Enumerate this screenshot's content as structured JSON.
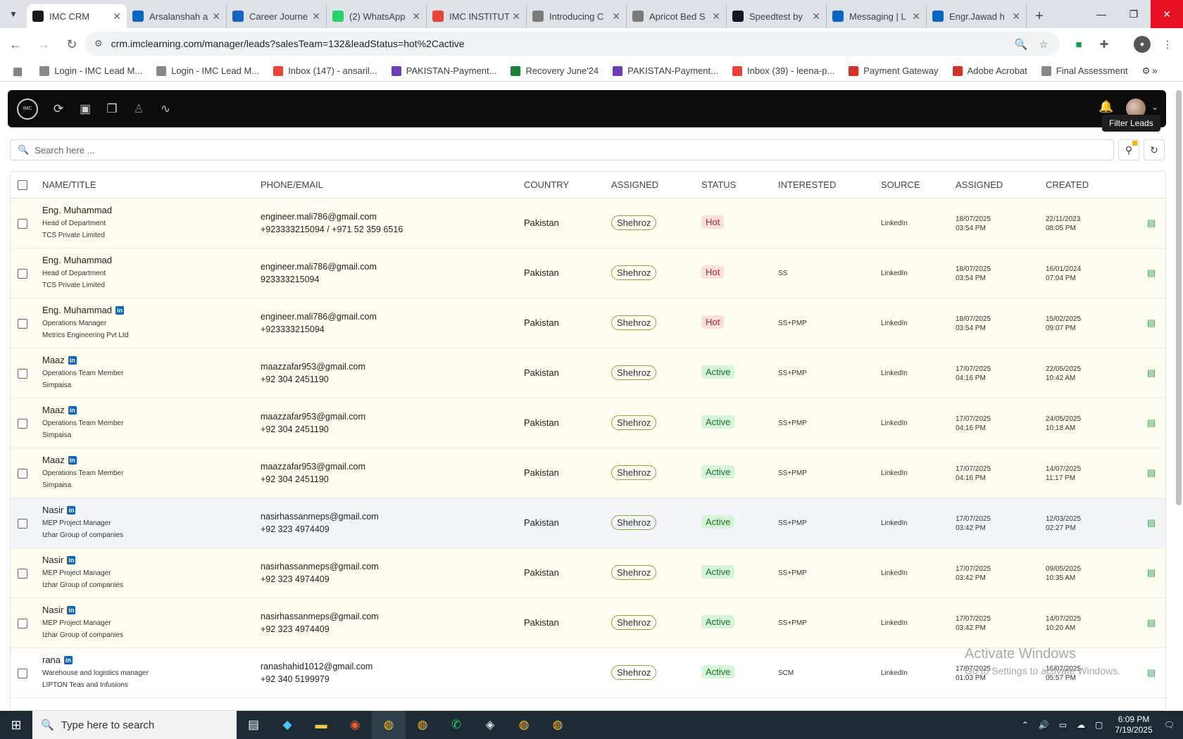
{
  "browser": {
    "tabs": [
      {
        "title": "IMC CRM",
        "fav": "#1a1a1a",
        "active": true
      },
      {
        "title": "Arsalanshah a",
        "fav": "#0a66c2"
      },
      {
        "title": "Career Journe",
        "fav": "#1565c0"
      },
      {
        "title": "(2) WhatsApp",
        "fav": "#25d366"
      },
      {
        "title": "IMC INSTITUT",
        "fav": "#ea4335"
      },
      {
        "title": "Introducing C",
        "fav": "#7a7a7a"
      },
      {
        "title": "Apricot Bed S",
        "fav": "#7a7a7a"
      },
      {
        "title": "Speedtest by",
        "fav": "#141526"
      },
      {
        "title": "Messaging | L",
        "fav": "#0a66c2"
      },
      {
        "title": "Engr.Jawad h",
        "fav": "#0a66c2"
      }
    ],
    "url": "crm.imclearning.com/manager/leads?salesTeam=132&leadStatus=hot%2Cactive",
    "bookmarks": [
      {
        "label": "Login - IMC Lead M...",
        "color": "#888"
      },
      {
        "label": "Login - IMC Lead M...",
        "color": "#888"
      },
      {
        "label": "Inbox (147) - ansaril...",
        "color": "#ea4335"
      },
      {
        "label": "PAKISTAN-Payment...",
        "color": "#6a3fb5"
      },
      {
        "label": "Recovery June'24",
        "color": "#188038"
      },
      {
        "label": "PAKISTAN-Payment...",
        "color": "#6a3fb5"
      },
      {
        "label": "Inbox (39) - leena-p...",
        "color": "#ea4335"
      },
      {
        "label": "Payment Gateway",
        "color": "#d93025"
      },
      {
        "label": "Adobe Acrobat",
        "color": "#d93025"
      },
      {
        "label": "Final Assessment",
        "color": "#888"
      }
    ]
  },
  "app": {
    "logo_text": "IMC",
    "tooltip": "Filter Leads",
    "search_placeholder": "Search here ..."
  },
  "table": {
    "headers": {
      "name": "NAME/TITLE",
      "contact": "PHONE/EMAIL",
      "country": "COUNTRY",
      "assigned": "ASSIGNED",
      "status": "STATUS",
      "interested": "INTERESTED",
      "source": "SOURCE",
      "assigned_date": "ASSIGNED",
      "created": "CREATED"
    },
    "rows": [
      {
        "name": "Eng. Muhammad",
        "li": false,
        "title": "Head of Department",
        "company": "TCS Private Limited",
        "email": "engineer.mali786@gmail.com",
        "phone": "+923333215094 / +971 52 359 6516",
        "country": "Pakistan",
        "assigned": "Shehroz",
        "status": "Hot",
        "interested": "",
        "source": "LinkedIn",
        "assigned_date": "18/07/2025",
        "assigned_time": "03:54 PM",
        "created_date": "22/11/2023",
        "created_time": "08:05 PM",
        "bg": "yl"
      },
      {
        "name": "Eng. Muhammad",
        "li": false,
        "title": "Head of Department",
        "company": "TCS Private Limited",
        "email": "engineer.mali786@gmail.com",
        "phone": "923333215094",
        "country": "Pakistan",
        "assigned": "Shehroz",
        "status": "Hot",
        "interested": "SS",
        "source": "LinkedIn",
        "assigned_date": "18/07/2025",
        "assigned_time": "03:54 PM",
        "created_date": "16/01/2024",
        "created_time": "07:04 PM",
        "bg": "yl"
      },
      {
        "name": "Eng. Muhammad",
        "li": true,
        "title": "Operations Manager",
        "company": "Metrics Engineering Pvt Ltd",
        "email": "engineer.mali786@gmail.com",
        "phone": "+923333215094",
        "country": "Pakistan",
        "assigned": "Shehroz",
        "status": "Hot",
        "interested": "SS+PMP",
        "source": "LinkedIn",
        "assigned_date": "18/07/2025",
        "assigned_time": "03:54 PM",
        "created_date": "15/02/2025",
        "created_time": "09:07 PM",
        "bg": "yl"
      },
      {
        "name": "Maaz",
        "li": true,
        "title": "Operations Team Member",
        "company": "Simpaisa",
        "email": "maazzafar953@gmail.com",
        "phone": "+92 304 2451190",
        "country": "Pakistan",
        "assigned": "Shehroz",
        "status": "Active",
        "interested": "SS+PMP",
        "source": "LinkedIn",
        "assigned_date": "17/07/2025",
        "assigned_time": "04:16 PM",
        "created_date": "22/05/2025",
        "created_time": "10:42 AM",
        "bg": "yl"
      },
      {
        "name": "Maaz",
        "li": true,
        "title": "Operations Team Member",
        "company": "Simpaisa",
        "email": "maazzafar953@gmail.com",
        "phone": "+92 304 2451190",
        "country": "Pakistan",
        "assigned": "Shehroz",
        "status": "Active",
        "interested": "SS+PMP",
        "source": "LinkedIn",
        "assigned_date": "17/07/2025",
        "assigned_time": "04:16 PM",
        "created_date": "24/05/2025",
        "created_time": "10:18 AM",
        "bg": "yl"
      },
      {
        "name": "Maaz",
        "li": true,
        "title": "Operations Team Member",
        "company": "Simpaisa",
        "email": "maazzafar953@gmail.com",
        "phone": "+92 304 2451190",
        "country": "Pakistan",
        "assigned": "Shehroz",
        "status": "Active",
        "interested": "SS+PMP",
        "source": "LinkedIn",
        "assigned_date": "17/07/2025",
        "assigned_time": "04:16 PM",
        "created_date": "14/07/2025",
        "created_time": "11:17 PM",
        "bg": "yl"
      },
      {
        "name": "Nasir",
        "li": true,
        "title": "MEP Project Manager",
        "company": "Izhar Group of companies",
        "email": "nasirhassanmeps@gmail.com",
        "phone": "+92 323 4974409",
        "country": "Pakistan",
        "assigned": "Shehroz",
        "status": "Active",
        "interested": "SS+PMP",
        "source": "LinkedIn",
        "assigned_date": "17/07/2025",
        "assigned_time": "03:42 PM",
        "created_date": "12/03/2025",
        "created_time": "02:27 PM",
        "bg": "gr"
      },
      {
        "name": "Nasir",
        "li": true,
        "title": "MEP Project Manager",
        "company": "Izhar Group of companies",
        "email": "nasirhassanmeps@gmail.com",
        "phone": "+92 323 4974409",
        "country": "Pakistan",
        "assigned": "Shehroz",
        "status": "Active",
        "interested": "SS+PMP",
        "source": "LinkedIn",
        "assigned_date": "17/07/2025",
        "assigned_time": "03:42 PM",
        "created_date": "09/05/2025",
        "created_time": "10:35 AM",
        "bg": "yl"
      },
      {
        "name": "Nasir",
        "li": true,
        "title": "MEP Project Manager",
        "company": "Izhar Group of companies",
        "email": "nasirhassanmeps@gmail.com",
        "phone": "+92 323 4974409",
        "country": "Pakistan",
        "assigned": "Shehroz",
        "status": "Active",
        "interested": "SS+PMP",
        "source": "LinkedIn",
        "assigned_date": "17/07/2025",
        "assigned_time": "03:42 PM",
        "created_date": "14/07/2025",
        "created_time": "10:20 AM",
        "bg": "yl"
      },
      {
        "name": "rana",
        "li": true,
        "title": "Warehouse and logistics manager",
        "company": "LIPTON Teas and Infusions",
        "email": "ranashahid1012@gmail.com",
        "phone": "+92 340 5199979",
        "country": "",
        "assigned": "Shehroz",
        "status": "Active",
        "interested": "SCM",
        "source": "LinkedIn",
        "assigned_date": "17/07/2025",
        "assigned_time": "01:03 PM",
        "created_date": "16/07/2025",
        "created_time": "05:57 PM",
        "bg": "wh"
      }
    ]
  },
  "watermark": {
    "line1": "Activate Windows",
    "line2": "Go to Settings to activate Windows."
  },
  "taskbar": {
    "search_placeholder": "Type here to search",
    "time": "6:09 PM",
    "date": "7/19/2025"
  }
}
